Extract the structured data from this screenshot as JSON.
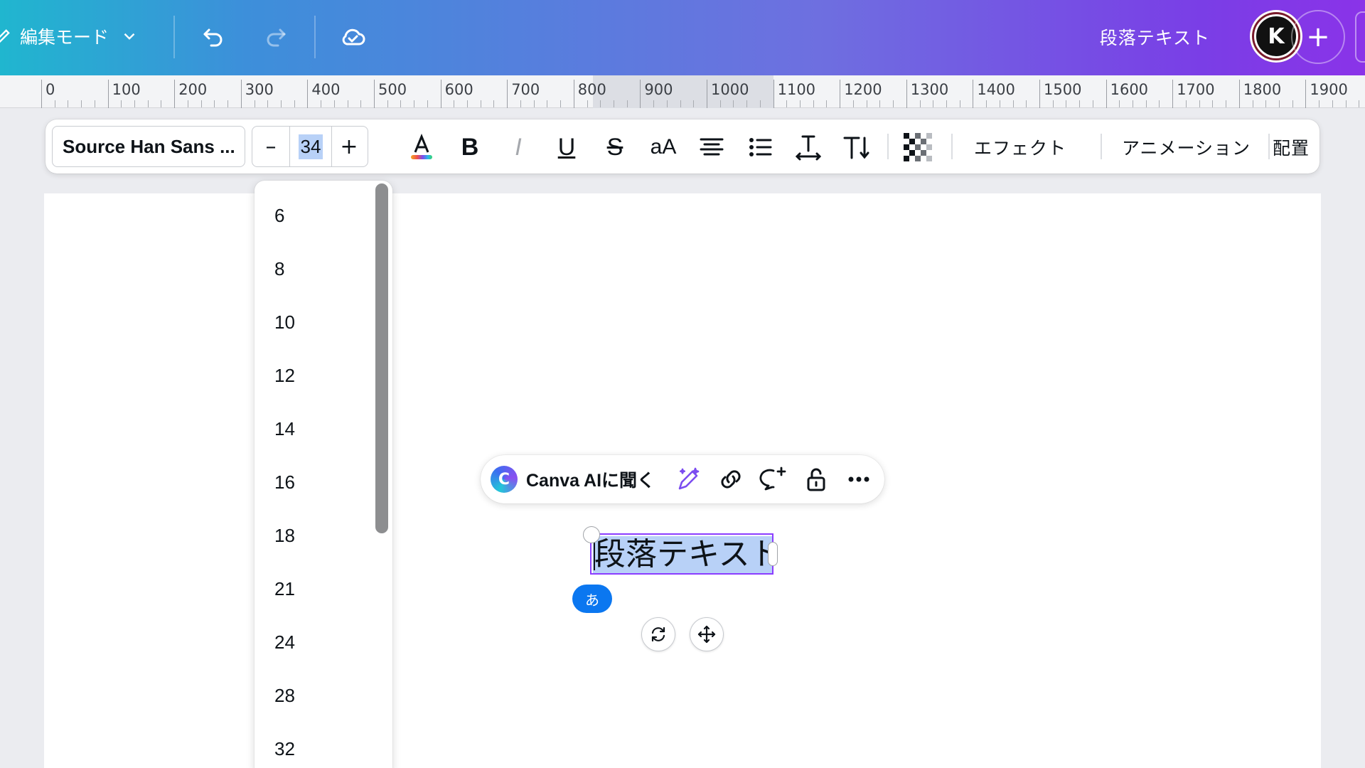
{
  "topbar": {
    "edit_mode_label": "編集モード",
    "doc_title": "段落テキスト",
    "avatar_letter": "K",
    "add_label": "+"
  },
  "ruler": {
    "labels": [
      "0",
      "100",
      "200",
      "300",
      "400",
      "500",
      "600",
      "700",
      "800",
      "900",
      "1000",
      "1100",
      "1200",
      "1300",
      "1400",
      "1500",
      "1600",
      "1700",
      "1800",
      "1900"
    ]
  },
  "text_toolbar": {
    "font_name": "Source Han Sans ...",
    "font_size": "34",
    "minus_label": "–",
    "plus_label": "+",
    "bold_glyph": "B",
    "italic_glyph": "I",
    "underline_glyph": "U",
    "strike_glyph": "S",
    "case_glyph": "aA",
    "effects_label": "エフェクト",
    "animation_label": "アニメーション",
    "position_label": "配置"
  },
  "size_dropdown": {
    "options": [
      "6",
      "8",
      "10",
      "12",
      "14",
      "16",
      "18",
      "21",
      "24",
      "28",
      "32"
    ]
  },
  "context_toolbar": {
    "ai_label": "Canva AIに聞く"
  },
  "canvas": {
    "text_content": "段落テキスト",
    "ime_badge": "あ"
  },
  "colors": {
    "accent": "#8b3dff",
    "selection": "#b8d1f7",
    "ime_blue": "#0b77f0"
  }
}
